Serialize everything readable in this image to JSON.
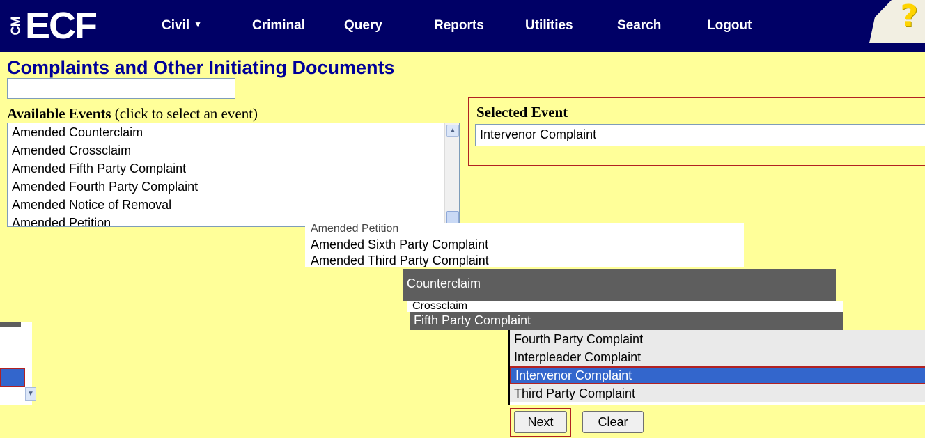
{
  "app": {
    "logo_side": "CM",
    "logo_main": "ECF"
  },
  "nav": {
    "civil": "Civil",
    "criminal": "Criminal",
    "query": "Query",
    "reports": "Reports",
    "utilities": "Utilities",
    "search": "Search",
    "logout": "Logout",
    "help": "?"
  },
  "page": {
    "title": "Complaints and Other Initiating Documents"
  },
  "search": {
    "value": "",
    "placeholder": ""
  },
  "available": {
    "label_bold": "Available Events",
    "label_rest": " (click to select an event)",
    "items": [
      "Amended Counterclaim",
      "Amended Crossclaim",
      "Amended Fifth Party Complaint",
      "Amended Fourth Party Complaint",
      "Amended Notice of Removal",
      "Amended Petition",
      "Amended Sixth Party Complaint",
      "Amended Third Party Complaint",
      "Counterclaim",
      "Crossclaim",
      "Fifth Party Complaint",
      "Fourth Party Complaint",
      "Interpleader Complaint",
      "Intervenor Complaint",
      "Third Party Complaint"
    ]
  },
  "selected": {
    "label": "Selected Event",
    "value": "Intervenor Complaint"
  },
  "buttons": {
    "next": "Next",
    "clear": "Clear"
  },
  "colors": {
    "background": "#FFFF99",
    "nav": "#000066",
    "title": "#000099",
    "highlight": "#3366CC",
    "outline": "#B22222"
  }
}
